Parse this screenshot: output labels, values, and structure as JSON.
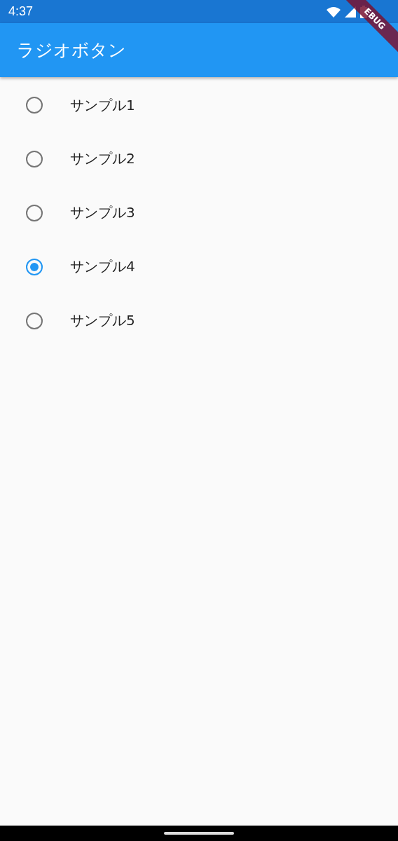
{
  "status_bar": {
    "time": "4:37"
  },
  "debug_banner": "EBUG",
  "app_bar": {
    "title": "ラジオボタン"
  },
  "radio_options": [
    {
      "label": "サンプル1",
      "selected": false
    },
    {
      "label": "サンプル2",
      "selected": false
    },
    {
      "label": "サンプル3",
      "selected": false
    },
    {
      "label": "サンプル4",
      "selected": true
    },
    {
      "label": "サンプル5",
      "selected": false
    }
  ]
}
